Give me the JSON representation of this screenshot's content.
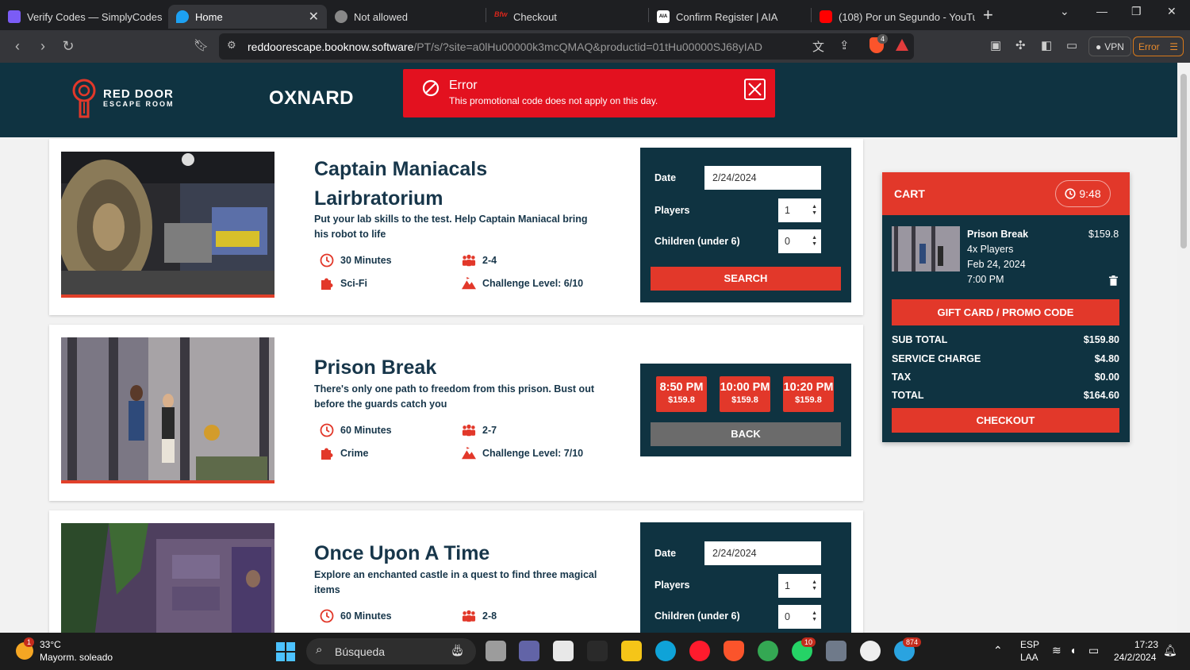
{
  "browser": {
    "tabs": [
      {
        "title": "Verify Codes — SimplyCodes",
        "color": "#7b5cf5"
      },
      {
        "title": "Home",
        "color": "#1da1f2",
        "active": true
      },
      {
        "title": "Not allowed",
        "color": "#888888"
      },
      {
        "title": "Checkout",
        "color": "#d6261c",
        "icon_text": "Bfw"
      },
      {
        "title": "Confirm Register | AIA",
        "color": "#ffffff",
        "icon_text": "AIA"
      },
      {
        "title": "(108) Por un Segundo - YouTube",
        "color": "#ff0000"
      }
    ],
    "url_host": "reddoorescape.booknow.software",
    "url_path": "/PT/s/?site=a0lHu00000k3mcQMAQ&productid=01tHu00000SJ68yIAD",
    "vpn_label": "VPN",
    "error_label": "Error",
    "shield_badge": "4"
  },
  "header": {
    "logo_line1": "RED DOOR",
    "logo_line2": "ESCAPE ROOM",
    "location": "OXNARD"
  },
  "error_toast": {
    "title": "Error",
    "message": "This promotional code does not apply on this day."
  },
  "rooms": [
    {
      "title": "Captain Maniacals Lairbratorium",
      "description": "Put your lab skills to the test. Help Captain Maniacal bring his robot to life",
      "duration": "30 Minutes",
      "players": "2-4",
      "genre": "Sci-Fi",
      "challenge": "Challenge Level: 6/10"
    },
    {
      "title": "Prison Break",
      "description": "There's only one path to freedom from this prison. Bust out before the guards catch you",
      "duration": "60 Minutes",
      "players": "2-7",
      "genre": "Crime",
      "challenge": "Challenge Level: 7/10"
    },
    {
      "title": "Once Upon A Time",
      "description": "Explore an enchanted castle in a quest to find three magical items",
      "duration": "60 Minutes",
      "players": "2-8"
    }
  ],
  "booking_form": {
    "date_label": "Date",
    "date_value": "2/24/2024",
    "players_label": "Players",
    "players_value": "1",
    "children_label": "Children (under 6)",
    "children_value": "0",
    "search_label": "SEARCH"
  },
  "time_slots": [
    {
      "time": "8:50 PM",
      "price": "$159.8"
    },
    {
      "time": "10:00 PM",
      "price": "$159.8"
    },
    {
      "time": "10:20 PM",
      "price": "$159.8"
    }
  ],
  "back_label": "BACK",
  "cart": {
    "title": "CART",
    "timer": "9:48",
    "item": {
      "name": "Prison Break",
      "price": "$159.8",
      "players": "4x Players",
      "date": "Feb 24, 2024",
      "time": "7:00 PM"
    },
    "promo_label": "GIFT CARD / PROMO CODE",
    "subtotal_label": "SUB TOTAL",
    "subtotal": "$159.80",
    "service_label": "SERVICE CHARGE",
    "service": "$4.80",
    "tax_label": "TAX",
    "tax": "$0.00",
    "total_label": "TOTAL",
    "total": "$164.60",
    "checkout_label": "CHECKOUT"
  },
  "taskbar": {
    "weather_temp": "33°C",
    "weather_desc": "Mayorm. soleado",
    "weather_badge": "1",
    "search_placeholder": "Búsqueda",
    "whatsapp_badge": "10",
    "telegram_badge": "874",
    "lang1": "ESP",
    "lang2": "LAA",
    "time": "17:23",
    "date": "24/2/2024"
  }
}
